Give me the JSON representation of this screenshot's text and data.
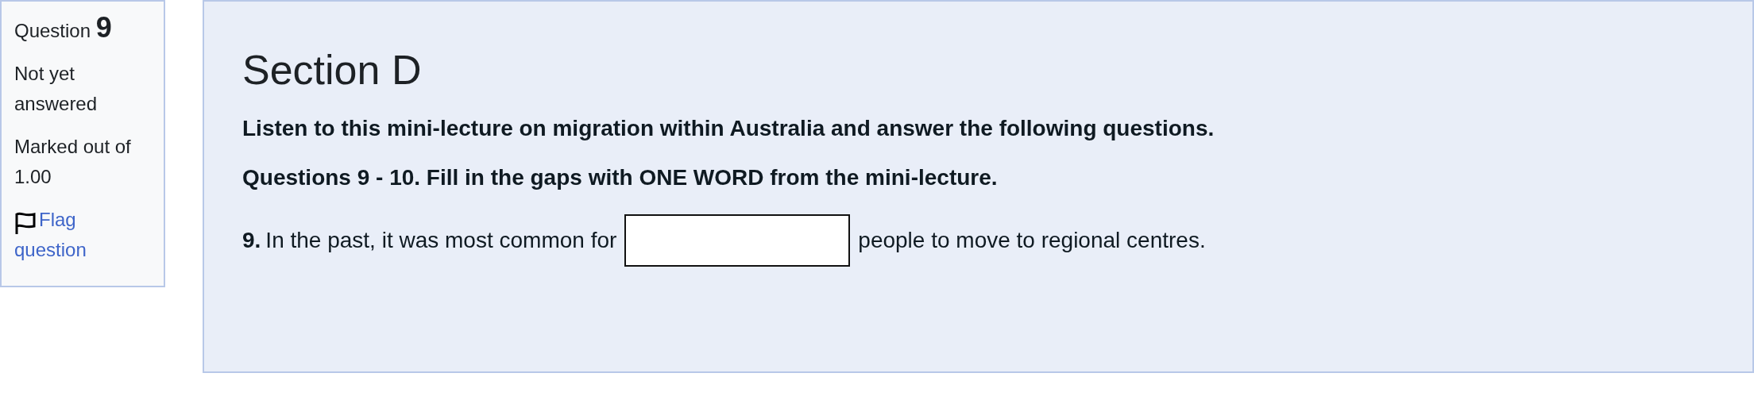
{
  "info": {
    "label": "Question",
    "number": "9",
    "status": "Not yet answered",
    "marks": "Marked out of 1.00",
    "flag_link": "Flag question"
  },
  "content": {
    "title": "Section D",
    "instructions": [
      "Listen to this mini-lecture on migration within Australia and answer the following questions.",
      "Questions 9 - 10. Fill in the gaps with ONE WORD from the mini-lecture."
    ],
    "question": {
      "number": "9.",
      "text_before": "In the past, it was most common for",
      "text_after": "people to move to regional centres."
    }
  }
}
